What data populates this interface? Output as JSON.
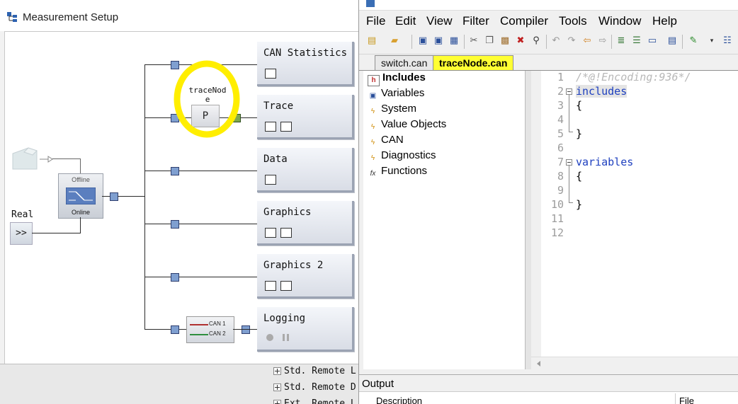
{
  "measurement_setup": {
    "title": "Measurement Setup",
    "source": {
      "offline_label": "Offline",
      "online_label": "Online",
      "real_label": "Real",
      "real_button": ">>"
    },
    "blocks": [
      {
        "label": "CAN Statistics"
      },
      {
        "label": "Trace"
      },
      {
        "label": "Data"
      },
      {
        "label": "Graphics"
      },
      {
        "label": "Graphics 2"
      },
      {
        "label": "Logging"
      }
    ],
    "node": {
      "name_line1": "traceNod",
      "name_line2": "e",
      "letter": "P"
    },
    "logging_filter": {
      "can1": "CAN 1",
      "can2": "CAN 2"
    },
    "bottom_tree": [
      {
        "label": "Std. Remote L"
      },
      {
        "label": "Std. Remote D"
      },
      {
        "label": "Ext. Remote L"
      }
    ]
  },
  "capl_browser": {
    "menu": [
      {
        "label": "File"
      },
      {
        "label": "Edit"
      },
      {
        "label": "View"
      },
      {
        "label": "Filter"
      },
      {
        "label": "Compiler"
      },
      {
        "label": "Tools"
      },
      {
        "label": "Window"
      },
      {
        "label": "Help"
      }
    ],
    "tabs": [
      {
        "label": "switch.can",
        "active": false
      },
      {
        "label": "traceNode.can",
        "active": true
      }
    ],
    "tree": [
      {
        "label": "Includes",
        "icon": "includes-icon"
      },
      {
        "label": "Variables",
        "icon": "variables-icon"
      },
      {
        "label": "System",
        "icon": "lightning-icon"
      },
      {
        "label": "Value Objects",
        "icon": "lightning-icon"
      },
      {
        "label": "CAN",
        "icon": "lightning-icon"
      },
      {
        "label": "Diagnostics",
        "icon": "lightning-icon"
      },
      {
        "label": "Functions",
        "icon": "function-icon"
      }
    ],
    "code": [
      {
        "n": "1",
        "text": "/*@!Encoding:936*/"
      },
      {
        "n": "2",
        "text": "includes"
      },
      {
        "n": "3",
        "text": "{"
      },
      {
        "n": "4",
        "text": ""
      },
      {
        "n": "5",
        "text": "}"
      },
      {
        "n": "6",
        "text": ""
      },
      {
        "n": "7",
        "text": "variables"
      },
      {
        "n": "8",
        "text": "{"
      },
      {
        "n": "9",
        "text": ""
      },
      {
        "n": "10",
        "text": "}"
      },
      {
        "n": "11",
        "text": ""
      },
      {
        "n": "12",
        "text": ""
      }
    ],
    "output": {
      "title": "Output",
      "columns": [
        "Description",
        "File"
      ]
    },
    "colors": {
      "active_tab": "#ffff33",
      "highlight_circle": "#ffee00",
      "keyword": "#1d3fbf",
      "comment": "#b8b8b8"
    }
  }
}
